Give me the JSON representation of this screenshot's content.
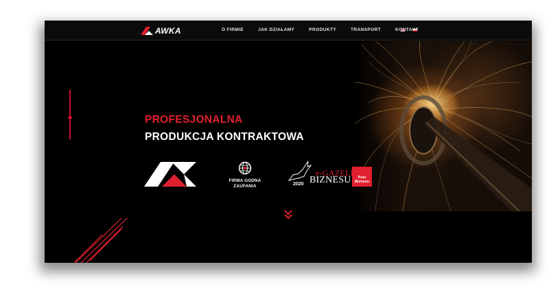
{
  "colors": {
    "accent": "#e1202f",
    "background": "#000000",
    "text": "#ffffff"
  },
  "logo": {
    "text": "AWKA"
  },
  "nav": {
    "items": [
      {
        "label": "O FIRMIE"
      },
      {
        "label": "JAK DZIAŁAMY"
      },
      {
        "label": "PRODUKTY"
      },
      {
        "label": "TRANSPORT"
      },
      {
        "label": "KONTAKT"
      }
    ]
  },
  "languages": [
    {
      "icon": "flag-en-icon"
    },
    {
      "icon": "flag-pl-icon"
    }
  ],
  "hero": {
    "headline_red": "PROFESJONALNA",
    "headline_white": "PRODUKCJA KONTRAKTOWA",
    "scroll_icon": "double-chevron-down-icon"
  },
  "badges": {
    "firma": {
      "line1": "FIRMA GODNA",
      "line2": "ZAUFANIA",
      "icon": "globe-icon"
    },
    "gazele": {
      "year": "2020",
      "title_top": "e-GAZELE",
      "title_bottom": "BIZNESU",
      "box_line1": "Puls",
      "box_line2": "Biznesu"
    }
  }
}
